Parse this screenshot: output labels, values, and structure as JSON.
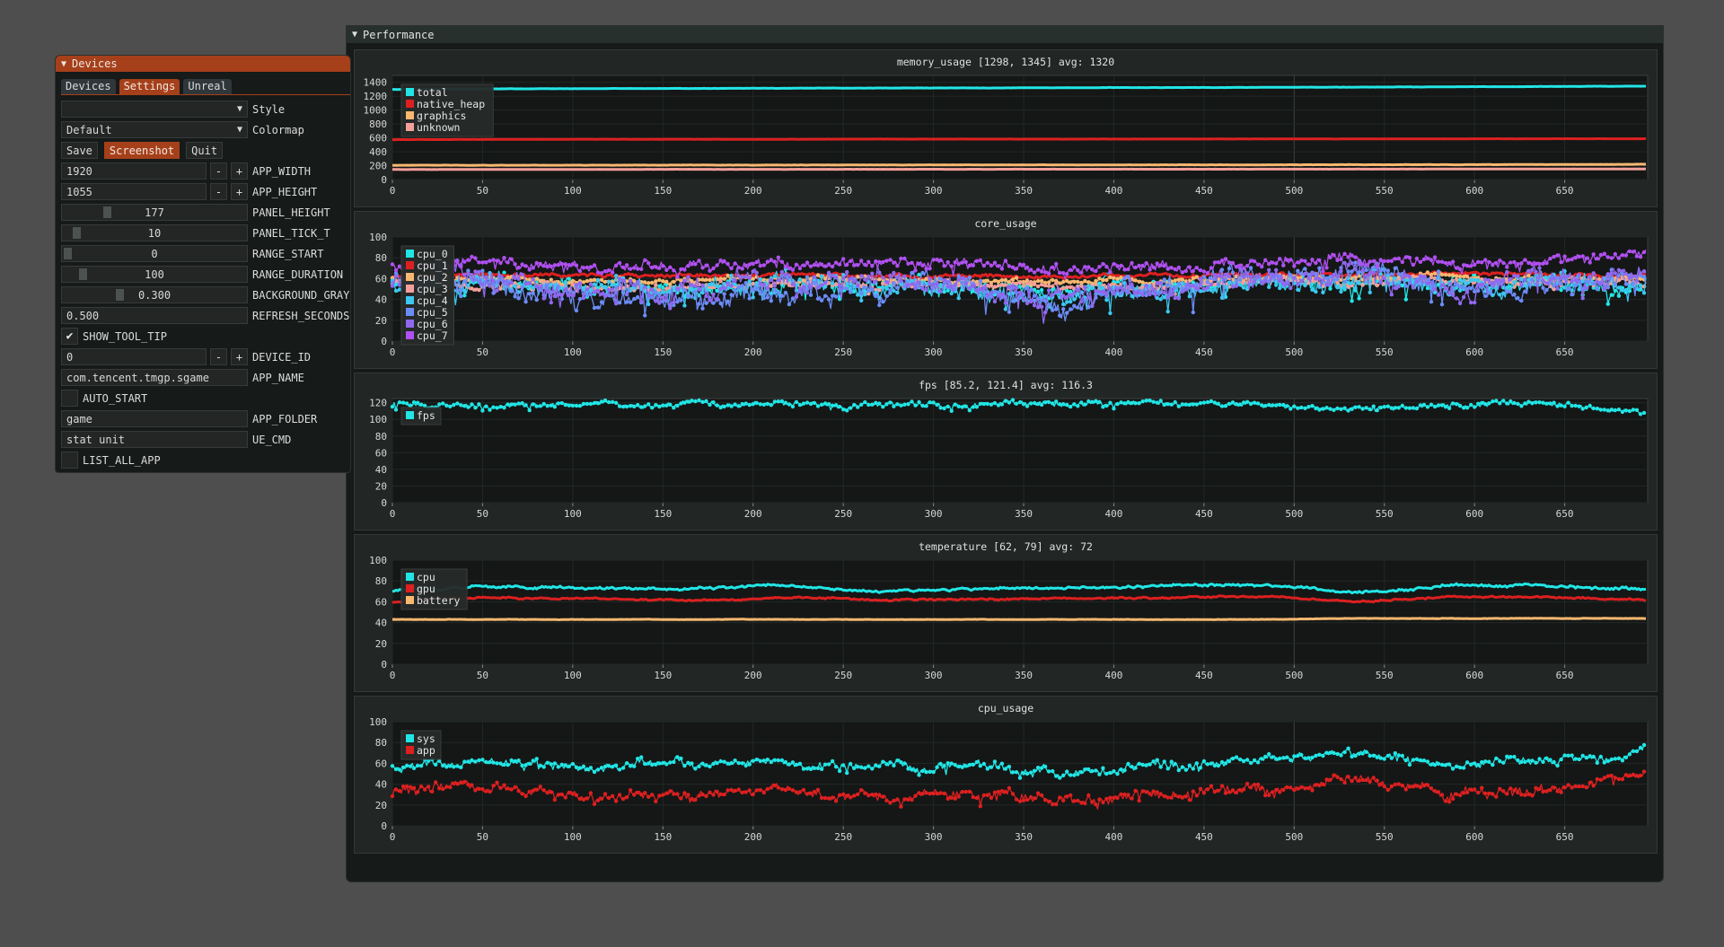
{
  "performance_window": {
    "title": "Performance",
    "collapse_icon": "triangle-down-icon"
  },
  "devices_window": {
    "title": "Devices",
    "collapse_icon": "triangle-down-icon",
    "tabs": [
      {
        "label": "Devices",
        "active": false
      },
      {
        "label": "Settings",
        "active": true
      },
      {
        "label": "Unreal",
        "active": false
      }
    ],
    "style": {
      "value": "",
      "label": "Style"
    },
    "colormap": {
      "value": "Default",
      "label": "Colormap"
    },
    "buttons": {
      "save": "Save",
      "screenshot": "Screenshot",
      "quit": "Quit"
    },
    "app_width": {
      "value": "1920",
      "label": "APP_WIDTH",
      "minus": "-",
      "plus": "+"
    },
    "app_height": {
      "value": "1055",
      "label": "APP_HEIGHT",
      "minus": "-",
      "plus": "+"
    },
    "panel_height": {
      "value": "177",
      "label": "PANEL_HEIGHT",
      "fraction": 0.23
    },
    "panel_tick_t": {
      "value": "10",
      "label": "PANEL_TICK_T",
      "fraction": 0.05
    },
    "range_start": {
      "value": "0",
      "label": "RANGE_START",
      "fraction": 0.0
    },
    "range_duration": {
      "value": "100",
      "label": "RANGE_DURATION",
      "fraction": 0.09
    },
    "background_gray": {
      "value": "0.300",
      "label": "BACKGROUND_GRAY",
      "fraction": 0.3
    },
    "refresh_seconds": {
      "value": "0.500",
      "label": "REFRESH_SECONDS"
    },
    "show_tool_tip": {
      "checked": true,
      "label": "SHOW_TOOL_TIP"
    },
    "device_id": {
      "value": "0",
      "label": "DEVICE_ID",
      "minus": "-",
      "plus": "+"
    },
    "app_name": {
      "value": "com.tencent.tmgp.sgame",
      "label": "APP_NAME"
    },
    "auto_start": {
      "checked": false,
      "label": "AUTO_START"
    },
    "app_folder": {
      "value": "game",
      "label": "APP_FOLDER"
    },
    "ue_cmd": {
      "value": "stat unit",
      "label": "UE_CMD"
    },
    "list_all_app": {
      "checked": false,
      "label": "LIST_ALL_APP"
    }
  },
  "colors": {
    "accent": "#a5401b",
    "cyan": "#22e5e5",
    "red": "#dc2020",
    "orange": "#f8b870",
    "pink": "#f4a09a",
    "sky": "#3cc8f0",
    "blue": "#6c8cf8",
    "violet": "#9068f0",
    "purple": "#b050f0"
  },
  "chart_data": [
    {
      "type": "line",
      "title": "memory_usage [1298, 1345] avg: 1320",
      "xlim": [
        0,
        696
      ],
      "ylim": [
        0,
        1500
      ],
      "xticks": [
        0,
        50,
        100,
        150,
        200,
        250,
        300,
        350,
        400,
        450,
        500,
        550,
        600,
        650
      ],
      "yticks": [
        0,
        200,
        400,
        600,
        800,
        1000,
        1200,
        1400
      ],
      "grid": true,
      "legend": "top-left",
      "series": [
        {
          "name": "total",
          "color": "#22e5e5",
          "base": [
            1298,
            1305,
            1310,
            1312,
            1315,
            1318,
            1320,
            1322,
            1325,
            1328,
            1332,
            1336,
            1340,
            1345
          ],
          "noise": 2
        },
        {
          "name": "native_heap",
          "color": "#dc2020",
          "base": [
            575,
            578,
            580,
            580,
            580,
            582,
            582,
            582,
            583,
            584,
            585,
            586,
            587,
            588
          ],
          "noise": 1
        },
        {
          "name": "graphics",
          "color": "#f8b870",
          "base": [
            205,
            206,
            207,
            208,
            208,
            209,
            210,
            210,
            211,
            212,
            213,
            214,
            216,
            220
          ],
          "noise": 2
        },
        {
          "name": "unknown",
          "color": "#f4a09a",
          "base": [
            145,
            146,
            146,
            147,
            147,
            148,
            148,
            149,
            149,
            150,
            150,
            151,
            152,
            153
          ],
          "noise": 1
        }
      ]
    },
    {
      "type": "line",
      "title": "core_usage",
      "xlim": [
        0,
        696
      ],
      "ylim": [
        0,
        100
      ],
      "xticks": [
        0,
        50,
        100,
        150,
        200,
        250,
        300,
        350,
        400,
        450,
        500,
        550,
        600,
        650
      ],
      "yticks": [
        0,
        20,
        40,
        60,
        80,
        100
      ],
      "grid": true,
      "legend": "top-left",
      "series": [
        {
          "name": "cpu_0",
          "color": "#22e5e5",
          "base": [
            55,
            58,
            52,
            50,
            56,
            55,
            54,
            48,
            52,
            56,
            55,
            58,
            50,
            52
          ],
          "noise": 8
        },
        {
          "name": "cpu_1",
          "color": "#dc2020",
          "base": [
            62,
            64,
            63,
            63,
            64,
            63,
            62,
            62,
            63,
            64,
            64,
            65,
            64,
            63
          ],
          "noise": 2
        },
        {
          "name": "cpu_2",
          "color": "#f8b870",
          "base": [
            60,
            60,
            58,
            58,
            60,
            60,
            58,
            57,
            58,
            60,
            60,
            62,
            60,
            60
          ],
          "noise": 3
        },
        {
          "name": "cpu_3",
          "color": "#f4a09a",
          "base": [
            56,
            55,
            52,
            52,
            55,
            55,
            54,
            52,
            54,
            56,
            56,
            58,
            56,
            58
          ],
          "noise": 4
        },
        {
          "name": "cpu_4",
          "color": "#3cc8f0",
          "base": [
            55,
            56,
            48,
            50,
            55,
            56,
            52,
            42,
            50,
            55,
            60,
            50,
            55,
            58
          ],
          "noise": 10
        },
        {
          "name": "cpu_5",
          "color": "#6c8cf8",
          "base": [
            58,
            60,
            40,
            42,
            52,
            55,
            55,
            35,
            50,
            58,
            62,
            42,
            55,
            60
          ],
          "noise": 12
        },
        {
          "name": "cpu_6",
          "color": "#9068f0",
          "base": [
            60,
            62,
            45,
            48,
            56,
            58,
            56,
            38,
            52,
            60,
            68,
            48,
            60,
            70
          ],
          "noise": 12
        },
        {
          "name": "cpu_7",
          "color": "#b050f0",
          "base": [
            74,
            78,
            70,
            72,
            74,
            76,
            74,
            68,
            72,
            76,
            80,
            72,
            76,
            86
          ],
          "noise": 6
        }
      ]
    },
    {
      "type": "line",
      "title": "fps [85.2, 121.4] avg: 116.3",
      "xlim": [
        0,
        696
      ],
      "ylim": [
        0,
        125
      ],
      "xticks": [
        0,
        50,
        100,
        150,
        200,
        250,
        300,
        350,
        400,
        450,
        500,
        550,
        600,
        650
      ],
      "yticks": [
        0,
        20,
        40,
        60,
        80,
        100,
        120
      ],
      "grid": true,
      "legend": "top-left",
      "series": [
        {
          "name": "fps",
          "color": "#22e5e5",
          "base": [
            119,
            116,
            117,
            118,
            117,
            118,
            119,
            119,
            119,
            117,
            113,
            118,
            118,
            108
          ],
          "noise": 4
        }
      ]
    },
    {
      "type": "line",
      "title": "temperature [62, 79] avg: 72",
      "xlim": [
        0,
        696
      ],
      "ylim": [
        0,
        100
      ],
      "xticks": [
        0,
        50,
        100,
        150,
        200,
        250,
        300,
        350,
        400,
        450,
        500,
        550,
        600,
        650
      ],
      "yticks": [
        0,
        20,
        40,
        60,
        80,
        100
      ],
      "grid": true,
      "legend": "top-left",
      "series": [
        {
          "name": "cpu",
          "color": "#22e5e5",
          "base": [
            70,
            75,
            73,
            72,
            76,
            70,
            72,
            74,
            75,
            77,
            68,
            76,
            75,
            72
          ],
          "noise": 1.5
        },
        {
          "name": "gpu",
          "color": "#dc2020",
          "base": [
            60,
            64,
            63,
            61,
            64,
            62,
            62,
            63,
            64,
            65,
            60,
            65,
            64,
            62
          ],
          "noise": 1
        },
        {
          "name": "battery",
          "color": "#f8b870",
          "base": [
            43,
            43,
            43,
            43,
            43,
            43,
            43,
            43,
            43,
            43,
            44,
            44,
            44,
            44
          ],
          "noise": 0.2
        }
      ]
    },
    {
      "type": "line",
      "title": "cpu_usage",
      "xlim": [
        0,
        696
      ],
      "ylim": [
        0,
        100
      ],
      "xticks": [
        0,
        50,
        100,
        150,
        200,
        250,
        300,
        350,
        400,
        450,
        500,
        550,
        600,
        650
      ],
      "yticks": [
        0,
        20,
        40,
        60,
        80,
        100
      ],
      "grid": true,
      "legend": "top-left",
      "series": [
        {
          "name": "sys",
          "color": "#22e5e5",
          "base": [
            58,
            62,
            55,
            60,
            62,
            54,
            58,
            50,
            58,
            62,
            70,
            58,
            64,
            72
          ],
          "noise": 5
        },
        {
          "name": "app",
          "color": "#dc2020",
          "base": [
            35,
            38,
            30,
            30,
            36,
            28,
            32,
            24,
            32,
            36,
            45,
            30,
            38,
            48
          ],
          "noise": 6
        }
      ]
    }
  ]
}
